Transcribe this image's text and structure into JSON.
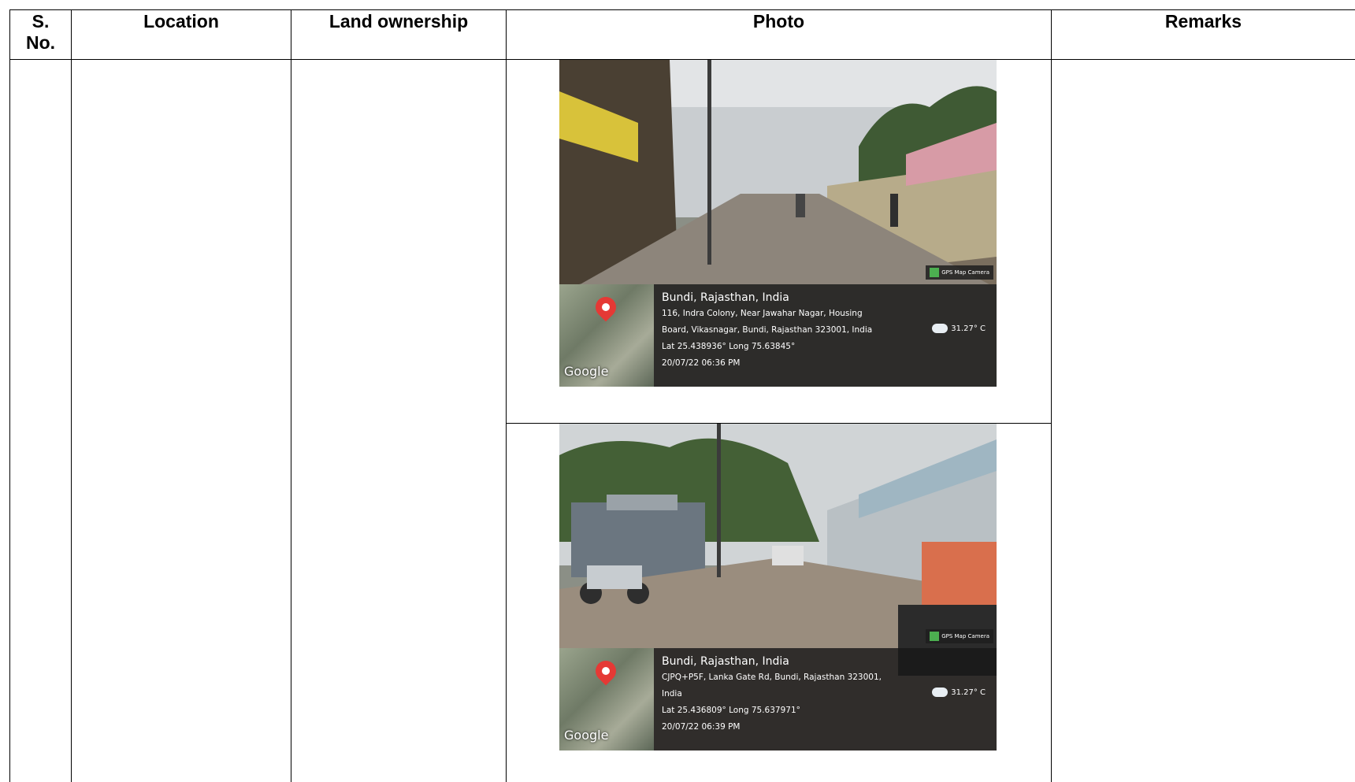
{
  "table": {
    "headers": {
      "sno": "S.\nNo.",
      "location": "Location",
      "land_ownership": "Land ownership",
      "photo": "Photo",
      "remarks": "Remarks"
    }
  },
  "photos": [
    {
      "place": "Bundi, Rajasthan, India",
      "address_line1": "116, Indra Colony, Near Jawahar Nagar, Housing",
      "address_line2": "Board, Vikasnagar, Bundi, Rajasthan 323001, India",
      "coords": "Lat 25.438936° Long 75.63845°",
      "datetime": "20/07/22 06:36 PM",
      "temperature": "31.27° C",
      "badge": "GPS Map Camera",
      "map_brand": "Google"
    },
    {
      "place": "Bundi, Rajasthan, India",
      "address_line1": "CJPQ+P5F, Lanka Gate Rd, Bundi, Rajasthan 323001,",
      "address_line2": "India",
      "coords": "Lat 25.436809° Long 75.637971°",
      "datetime": "20/07/22 06:39 PM",
      "temperature": "31.27° C",
      "badge": "GPS Map Camera",
      "map_brand": "Google"
    }
  ]
}
